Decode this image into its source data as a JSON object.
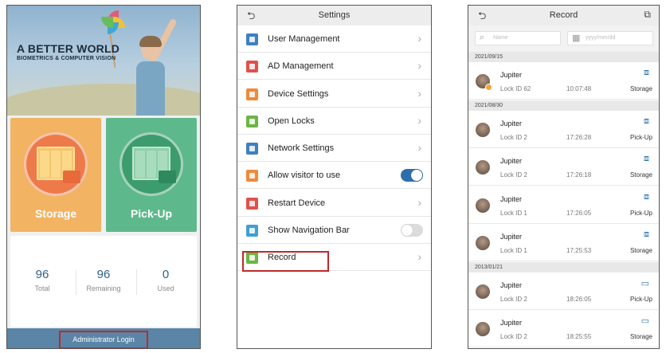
{
  "home": {
    "banner_title": "A BETTER WORLD",
    "banner_subtitle": "BIOMETRICS & COMPUTER VISION",
    "storage_label": "Storage",
    "pickup_label": "Pick-Up",
    "stats": [
      {
        "value": "96",
        "label": "Total"
      },
      {
        "value": "96",
        "label": "Remaining"
      },
      {
        "value": "0",
        "label": "Used"
      }
    ],
    "admin_login": "Administrator Login",
    "colors": {
      "storage": "#f2b362",
      "pickup": "#5db98c",
      "footer": "#5a85a6",
      "highlight": "#c0282b"
    }
  },
  "settings": {
    "title": "Settings",
    "back_icon": "back-arrow-icon",
    "items": [
      {
        "label": "User Management",
        "icon": "user-icon",
        "color": "#3f7fc4",
        "control": "chevron"
      },
      {
        "label": "AD Management",
        "icon": "ad-icon",
        "color": "#e0514c",
        "control": "chevron"
      },
      {
        "label": "Device Settings",
        "icon": "device-icon",
        "color": "#ef8a3a",
        "control": "chevron"
      },
      {
        "label": "Open Locks",
        "icon": "lock-icon",
        "color": "#6cb544",
        "control": "chevron"
      },
      {
        "label": "Network Settings",
        "icon": "globe-icon",
        "color": "#3f7fc4",
        "control": "chevron"
      },
      {
        "label": "Allow visitor to use",
        "icon": "visitor-icon",
        "color": "#ef8a3a",
        "control": "toggle",
        "on": true
      },
      {
        "label": "Restart Device",
        "icon": "restart-icon",
        "color": "#e0514c",
        "control": "chevron"
      },
      {
        "label": "Show Navigation Bar",
        "icon": "nav-icon",
        "color": "#3f9fd6",
        "control": "toggle",
        "on": false
      },
      {
        "label": "Record",
        "icon": "record-icon",
        "color": "#6cb544",
        "control": "chevron"
      }
    ]
  },
  "record": {
    "title": "Record",
    "name_placeholder": "Name",
    "date_placeholder": "yyyy/mm/dd",
    "groups": [
      {
        "date": "2021/09/15",
        "rows": [
          {
            "name": "Jupiter",
            "lock": "Lock ID 62",
            "time": "10:07:48",
            "op": "Storage",
            "method": "face-scan-icon",
            "badge": true
          }
        ]
      },
      {
        "date": "2021/08/30",
        "rows": [
          {
            "name": "Jupiter",
            "lock": "Lock ID 2",
            "time": "17:26:28",
            "op": "Pick-Up",
            "method": "face-scan-icon"
          },
          {
            "name": "Jupiter",
            "lock": "Lock ID 2",
            "time": "17:26:18",
            "op": "Storage",
            "method": "face-scan-icon"
          },
          {
            "name": "Jupiter",
            "lock": "Lock ID 1",
            "time": "17:26:05",
            "op": "Pick-Up",
            "method": "face-scan-icon"
          },
          {
            "name": "Jupiter",
            "lock": "Lock ID 1",
            "time": "17:25:53",
            "op": "Storage",
            "method": "face-scan-icon"
          }
        ]
      },
      {
        "date": "2013/01/21",
        "rows": [
          {
            "name": "Jupiter",
            "lock": "Lock ID 2",
            "time": "18:26:05",
            "op": "Pick-Up",
            "method": "card-icon"
          },
          {
            "name": "Jupiter",
            "lock": "Lock ID 2",
            "time": "18:25:55",
            "op": "Storage",
            "method": "card-icon"
          }
        ]
      }
    ]
  }
}
